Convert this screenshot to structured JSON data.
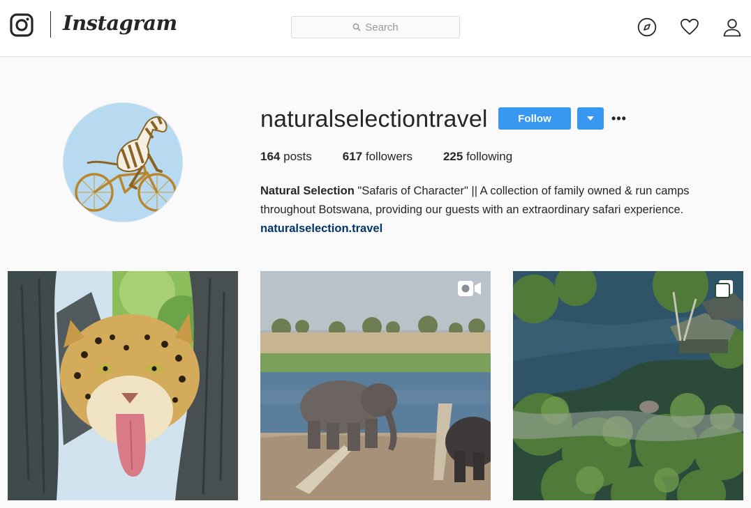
{
  "header": {
    "wordmark": "Instagram",
    "search_placeholder": "Search",
    "icons": [
      "instagram-logo-icon",
      "search-icon",
      "compass-icon",
      "heart-icon",
      "person-icon"
    ]
  },
  "profile": {
    "username": "naturalselectiontravel",
    "follow_label": "Follow",
    "more_label": "•••",
    "stats": {
      "posts_count": "164",
      "posts_label": "posts",
      "followers_count": "617",
      "followers_label": "followers",
      "following_count": "225",
      "following_label": "following"
    },
    "bio": {
      "name": "Natural Selection",
      "text": " \"Safaris of Character\" || A collection of family owned & run camps throughout Botswana, providing our guests with an extraordinary safari experience.",
      "link": "naturalselection.travel"
    }
  },
  "grid": {
    "posts": [
      {
        "subject": "leopard",
        "badge": "none"
      },
      {
        "subject": "elephants-at-river",
        "badge": "video-icon"
      },
      {
        "subject": "aerial-delta-camp",
        "badge": "multiple-photos-icon"
      }
    ]
  },
  "colors": {
    "accent": "#3897f0",
    "link": "#003569",
    "border": "#dbdbdb",
    "background": "#fafafa"
  }
}
